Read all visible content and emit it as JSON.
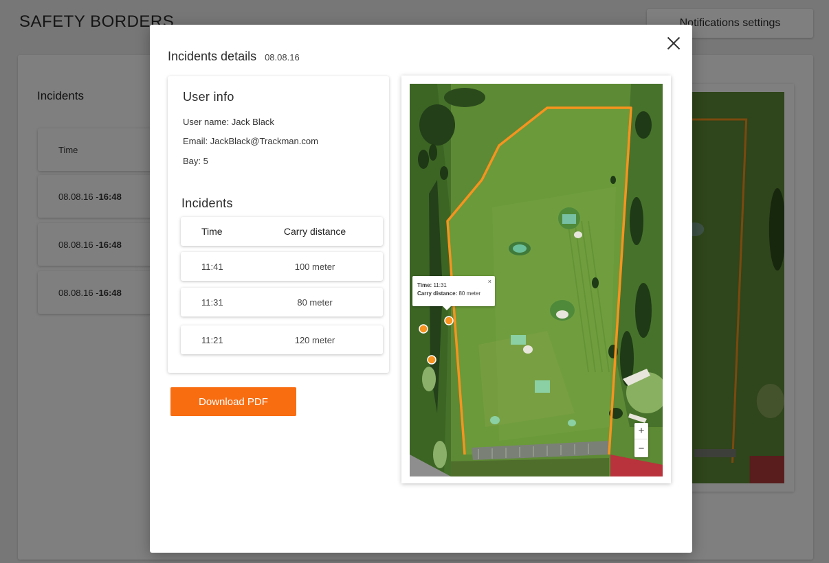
{
  "background": {
    "app_title": "SAFETY BORDERS",
    "notifications_label": "Notifications settings",
    "incidents_title": "Incidents",
    "table_header_time": "Time",
    "rows": [
      {
        "date": "08.08.16 - ",
        "time": "16:48"
      },
      {
        "date": "08.08.16 - ",
        "time": "16:48"
      },
      {
        "date": "08.08.16 - ",
        "time": "16:48"
      }
    ]
  },
  "modal": {
    "title": "Incidents details",
    "date": "08.08.16",
    "user_info": {
      "title": "User info",
      "name_line": "User name:  Jack Black",
      "email_line": "Email:  JackBlack@Trackman.com",
      "bay_line": "Bay: 5"
    },
    "incidents": {
      "title": "Incidents",
      "headers": {
        "time": "Time",
        "carry": "Carry distance"
      },
      "rows": [
        {
          "time": "11:41",
          "carry": "100 meter"
        },
        {
          "time": "11:31",
          "carry": "80 meter"
        },
        {
          "time": "11:21",
          "carry": "120 meter"
        }
      ]
    },
    "download_label": "Download PDF",
    "map": {
      "tooltip": {
        "time_label": "Time:",
        "time_value": "11:31",
        "carry_label": "Carry distance:",
        "carry_value": "80 meter",
        "close": "×"
      },
      "zoom_in": "+",
      "zoom_out": "−",
      "border_color": "#f7931e",
      "marker_color": "#f7931e"
    }
  },
  "colors": {
    "accent": "#f96d11",
    "overlay": "rgba(0,0,0,0.5)"
  }
}
